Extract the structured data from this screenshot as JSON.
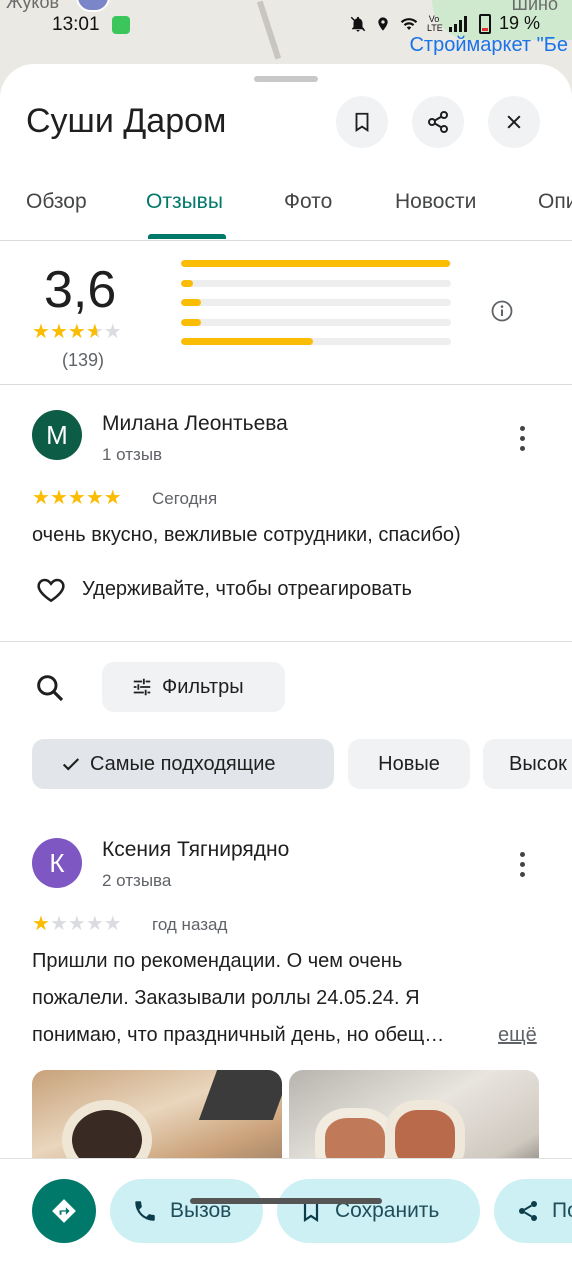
{
  "status_bar": {
    "time": "13:01",
    "battery": "19 %",
    "volte": "Vo LTE"
  },
  "map": {
    "label_top": "Шино",
    "label_left": "Жуков",
    "store_label": "Строймаркет \"Бе"
  },
  "place": {
    "title": "Суши Даром"
  },
  "tabs": [
    "Обзор",
    "Отзывы",
    "Фото",
    "Новости",
    "Опи"
  ],
  "summary": {
    "rating": "3,6",
    "rating_value": 3.6,
    "count": "(139)",
    "distribution": [
      0.998,
      0.045,
      0.075,
      0.075,
      0.49
    ]
  },
  "reviews": [
    {
      "initial": "М",
      "avatar_color": "#0d5c45",
      "name": "Милана Леонтьева",
      "sub": "1 отзыв",
      "stars": 5,
      "date": "Сегодня",
      "text": "очень вкусно, вежливые сотрудники, спасибо)",
      "react_label": "Удерживайте, чтобы отреагировать"
    },
    {
      "initial": "К",
      "avatar_color": "#7e57c2",
      "name": "Ксения Тягнирядно",
      "sub": "2 отзыва",
      "stars": 1,
      "date": "год назад",
      "text_line1": "Пришли по рекомендации. О чем очень",
      "text_line2": "пожалели. Заказывали роллы 24.05.24. Я",
      "text_line3": "понимаю, что праздничный день, но обещ…",
      "more_link": "ещё"
    }
  ],
  "filters": {
    "filters_label": "Фильтры",
    "sort_chips": [
      "Самые подходящие",
      "Новые",
      "Высок"
    ]
  },
  "actions": {
    "call": "Вызов",
    "save": "Сохранить",
    "share": "По"
  },
  "colors": {
    "accent": "#00796b",
    "star": "#fbbc04",
    "chip": "#f0f2f4",
    "action_chip": "#cdf0f4"
  }
}
